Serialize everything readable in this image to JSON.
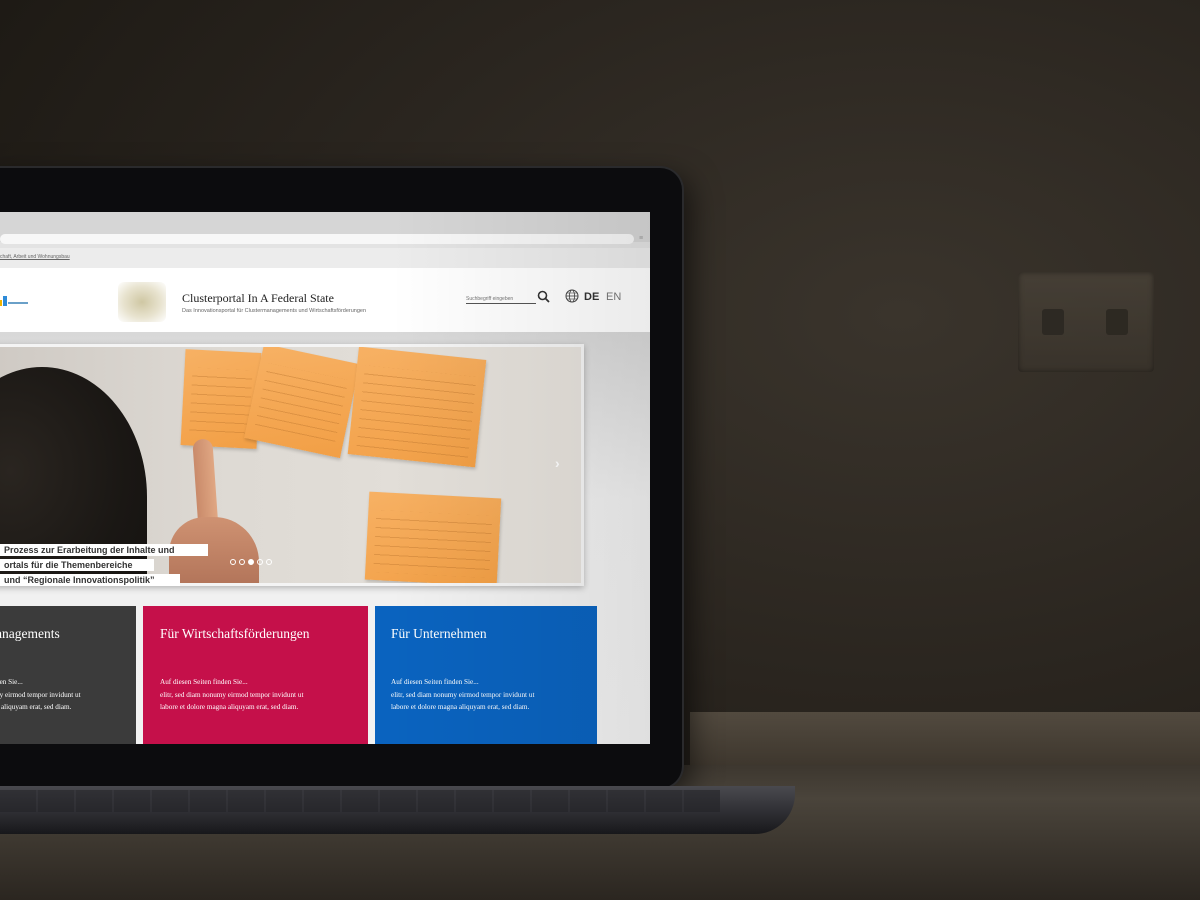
{
  "browser": {
    "ministry_link": "chaft, Arbeit und Wohnungsbau",
    "menu_icon": "hamburger-icon"
  },
  "header": {
    "site_title": "Clusterportal In A Federal State",
    "site_subtitle": "Das Innovationsportal für Clustermanagements und Wirtschaftsförderungen",
    "search_placeholder": "Suchbegriff eingeben",
    "lang_de": "DE",
    "lang_en": "EN"
  },
  "hero": {
    "caption_lines": [
      " Prozess zur Erarbeitung der Inhalte und",
      "ortals für die Themenbereiche",
      "und “Regionale Innovationspolitik”"
    ],
    "slide_count": 5,
    "active_slide": 3,
    "next_icon": "chevron-right-icon"
  },
  "cards": [
    {
      "title": "anagements",
      "text": "den Sie...\nny eirmod tempor invidunt ut\na aliquyam erat, sed diam.",
      "color": "#3b3b3b"
    },
    {
      "title": "Für Wirtschaftsförderungen",
      "text": "Auf diesen Seiten finden Sie...\nelitr, sed diam nonumy eirmod tempor invidunt ut\nlabore et dolore magna aliquyam erat, sed diam.",
      "color": "#c5104a"
    },
    {
      "title": "Für Unternehmen",
      "text": "Auf diesen Seiten finden Sie...\nelitr, sed diam nonumy eirmod tempor invidunt ut\nlabore et dolore magna aliquyam erat, sed diam.",
      "color": "#0a63bf"
    }
  ]
}
